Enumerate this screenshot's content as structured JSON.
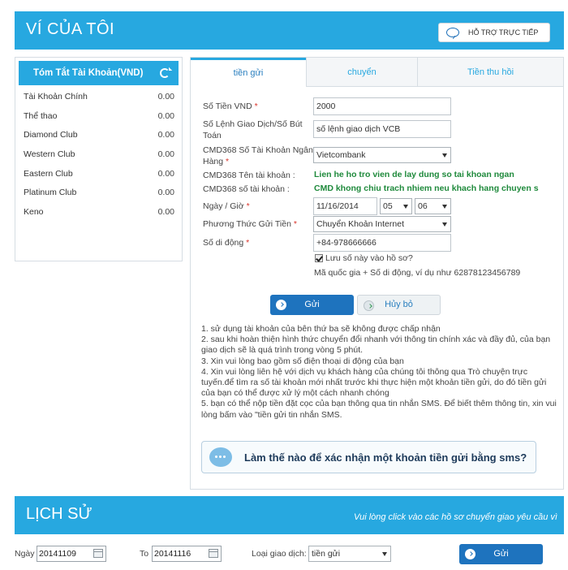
{
  "header": {
    "title": "VÍ CỦA TÔI",
    "support_label": "HỖ TRỢ TRỰC TIẾP"
  },
  "summary": {
    "title": "Tóm Tắt Tài Khoản(VND)",
    "accounts": [
      {
        "name": "Tài Khoản Chính",
        "amount": "0.00"
      },
      {
        "name": "Thể thao",
        "amount": "0.00"
      },
      {
        "name": "Diamond Club",
        "amount": "0.00"
      },
      {
        "name": "Western Club",
        "amount": "0.00"
      },
      {
        "name": "Eastern Club",
        "amount": "0.00"
      },
      {
        "name": "Platinum Club",
        "amount": "0.00"
      },
      {
        "name": "Keno",
        "amount": "0.00"
      }
    ]
  },
  "tabs": [
    {
      "label": "tiền gửi"
    },
    {
      "label": "chuyển"
    },
    {
      "label": "Tiền thu hồi"
    }
  ],
  "form": {
    "amount_label": "Số Tiền VND",
    "amount_value": "2000",
    "ref_label": "Số Lệnh Giao Dịch/Số Bút Toán",
    "ref_value": "số lệnh giao dịch VCB",
    "bank_label": "CMD368 Số Tài Khoản Ngân Hàng",
    "bank_value": "Vietcombank",
    "acc_name_label": "CMD368 Tên tài khoản :",
    "acc_name_value": "Lien he ho tro vien de lay dung so tai khoan ngan",
    "acc_no_label": "CMD368 số tài khoản :",
    "acc_no_value": "CMD khong chiu trach nhiem neu khach hang chuyen s",
    "datetime_label": "Ngày / Giờ",
    "date_value": "11/16/2014",
    "hour_value": "05",
    "minute_value": "06",
    "method_label": "Phương Thức Gửi Tiền",
    "method_value": "Chuyển Khoản Internet",
    "phone_label": "Số di động",
    "phone_value": "+84-978666666",
    "save_label": "Lưu số này vào hồ sơ?",
    "phone_hint": "Mã quốc gia + Số di động, ví dụ như 62878123456789",
    "required_mark": "*"
  },
  "buttons": {
    "send": "Gửi",
    "cancel": "Hủy bỏ"
  },
  "notes": [
    "1. sử dụng tài khoản của bên thứ ba sẽ không được chấp nhận",
    "2. sau khi hoàn thiện hình thức chuyển đổi nhanh với thông tin chính xác và đầy đủ, của bạn giao dịch sẽ là quá trình trong vòng 5 phút.",
    "3. Xin vui lòng bao gồm số điện thoại di động của bạn",
    "4. Xin vui lòng liên hệ với dịch vụ khách hàng của chúng tôi thông qua Trò chuyện trực tuyến.để tìm ra số tài khoản mới nhất trước khi thực hiện một khoản tiền gửi, do đó tiền gửi của bạn có thể được xử lý một cách nhanh chóng",
    "5. bạn có thể nộp tiền đặt cọc của bạn thông qua tin nhắn SMS. Để biết thêm thông tin, xin vui lòng bấm vào \"tiền gửi tin nhắn SMS."
  ],
  "sms_banner": "Làm thế nào để xác nhận một khoản tiền gửi bằng sms?",
  "history": {
    "title": "LỊCH SỬ",
    "hint": "Vui lòng click vào các hồ sơ chuyển giao yêu cầu vì",
    "from_label": "Ngày",
    "from_value": "20141109",
    "to_label": "To",
    "to_value": "20141116",
    "type_label": "Loại giao dịch:",
    "type_value": "tiền gửi",
    "send": "Gửi"
  }
}
